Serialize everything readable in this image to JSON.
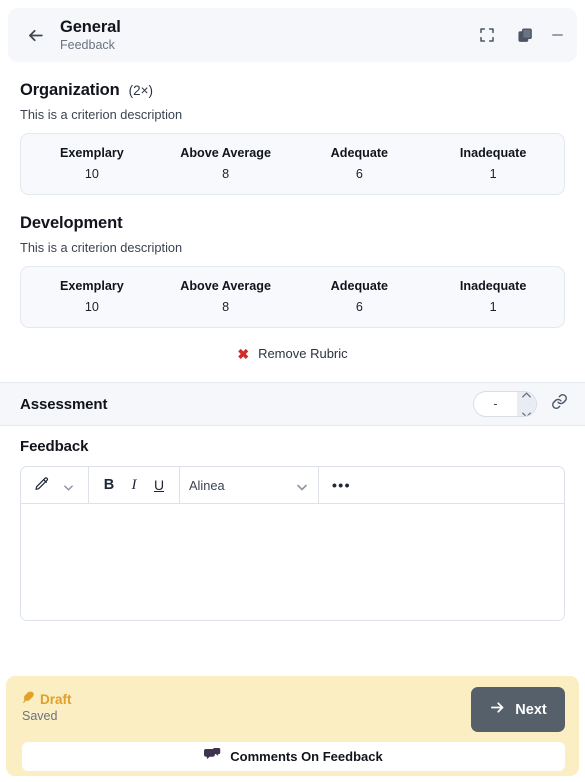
{
  "header": {
    "back_icon": "arrow-left-icon",
    "title": "General",
    "subtitle": "Feedback",
    "actions": {
      "fullscreen_icon": "fullscreen-icon",
      "duplicate_icon": "copy-icon",
      "minimize_icon": "minimize-icon"
    }
  },
  "criteria": [
    {
      "name": "Organization",
      "multiplier": "(2×)",
      "description": "This is a criterion description",
      "levels": [
        {
          "label": "Exemplary",
          "score": "10"
        },
        {
          "label": "Above Average",
          "score": "8"
        },
        {
          "label": "Adequate",
          "score": "6"
        },
        {
          "label": "Inadequate",
          "score": "1"
        }
      ]
    },
    {
      "name": "Development",
      "multiplier": "",
      "description": "This is a criterion description",
      "levels": [
        {
          "label": "Exemplary",
          "score": "10"
        },
        {
          "label": "Above Average",
          "score": "8"
        },
        {
          "label": "Adequate",
          "score": "6"
        },
        {
          "label": "Inadequate",
          "score": "1"
        }
      ]
    }
  ],
  "remove_rubric": {
    "icon": "cross-icon",
    "icon_glyph": "✖",
    "label": "Remove Rubric",
    "color": "#d12b2b"
  },
  "assessment": {
    "title": "Assessment",
    "grade_value": "-",
    "grade_placeholder": "-",
    "link_icon": "link-icon"
  },
  "feedback": {
    "title": "Feedback",
    "toolbar": {
      "highlight_icon": "pencil-icon",
      "bold_label": "B",
      "italic_label": "I",
      "underline_label": "U",
      "style_value": "Alinea",
      "more_label": "•••"
    },
    "body_value": "",
    "body_placeholder": ""
  },
  "footer": {
    "status_icon": "feather-icon",
    "status_label": "Draft",
    "saved_label": "Saved",
    "next_label": "Next",
    "next_icon": "arrow-right-icon",
    "next_color": "#55606b",
    "comments_icon": "comments-icon",
    "comments_label": "Comments On Feedback",
    "background_color": "#faeec2",
    "status_color": "#e0a02a"
  }
}
